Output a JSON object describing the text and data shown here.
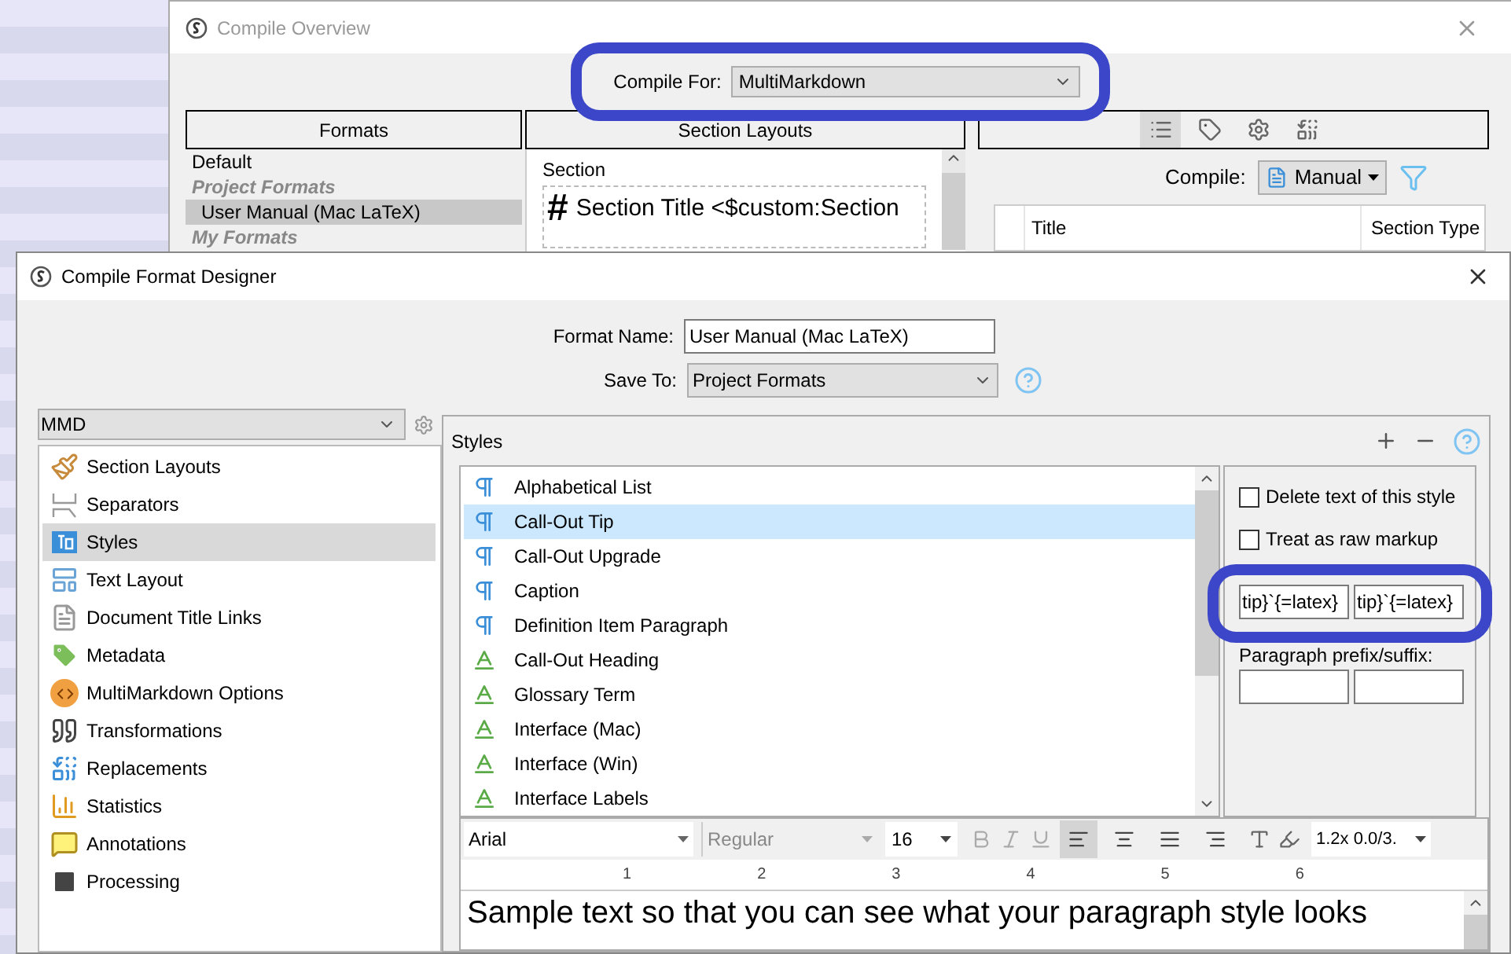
{
  "overview": {
    "title": "Compile Overview",
    "compile_for": {
      "label": "Compile For:",
      "value": "MultiMarkdown"
    },
    "headers": [
      "Formats",
      "Section Layouts"
    ],
    "view_tabs": [
      {
        "selected": true
      },
      {
        "selected": false
      },
      {
        "selected": false
      },
      {
        "selected": false
      }
    ],
    "formats": [
      {
        "kind": "item",
        "label": "Default",
        "selected": false
      },
      {
        "kind": "heading",
        "label": "Project Formats"
      },
      {
        "kind": "item",
        "label": "User Manual (Mac LaTeX)",
        "selected": true
      },
      {
        "kind": "heading",
        "label": "My Formats"
      }
    ],
    "section_layout": {
      "label": "Section",
      "marker": "#",
      "title": "Section Title <$custom:Section"
    },
    "compile": {
      "label": "Compile:",
      "value": "Manual"
    },
    "columns": [
      "Title",
      "Section Type"
    ]
  },
  "designer": {
    "title": "Compile Format Designer",
    "format_name": {
      "label": "Format Name:",
      "value": "User Manual (Mac LaTeX)"
    },
    "save_to": {
      "label": "Save To:",
      "value": "Project Formats"
    },
    "format_select": "MMD",
    "sidebar": [
      {
        "label": "Section Layouts",
        "selected": false
      },
      {
        "label": "Separators",
        "selected": false
      },
      {
        "label": "Styles",
        "selected": true
      },
      {
        "label": "Text Layout",
        "selected": false
      },
      {
        "label": "Document Title Links",
        "selected": false
      },
      {
        "label": "Metadata",
        "selected": false
      },
      {
        "label": "MultiMarkdown Options",
        "selected": false
      },
      {
        "label": "Transformations",
        "selected": false
      },
      {
        "label": "Replacements",
        "selected": false
      },
      {
        "label": "Statistics",
        "selected": false
      },
      {
        "label": "Annotations",
        "selected": false
      },
      {
        "label": "Processing",
        "selected": false
      }
    ],
    "styles_label": "Styles",
    "styles": [
      {
        "kind": "paragraph",
        "label": "Alphabetical List",
        "selected": false
      },
      {
        "kind": "paragraph",
        "label": "Call-Out Tip",
        "selected": true
      },
      {
        "kind": "paragraph",
        "label": "Call-Out Upgrade",
        "selected": false
      },
      {
        "kind": "paragraph",
        "label": "Caption",
        "selected": false
      },
      {
        "kind": "paragraph",
        "label": "Definition Item Paragraph",
        "selected": false
      },
      {
        "kind": "character",
        "label": "Call-Out Heading",
        "selected": false
      },
      {
        "kind": "character",
        "label": "Glossary Term",
        "selected": false
      },
      {
        "kind": "character",
        "label": "Interface (Mac)",
        "selected": false
      },
      {
        "kind": "character",
        "label": "Interface (Win)",
        "selected": false
      },
      {
        "kind": "character",
        "label": "Interface Labels",
        "selected": false
      }
    ],
    "options": [
      {
        "label": "Delete text of this style",
        "checked": false
      },
      {
        "label": "Treat as raw markup",
        "checked": false
      }
    ],
    "prefix_fields": [
      "tip}`{=latex}",
      "tip}`{=latex}"
    ],
    "paragraph_label": "Paragraph prefix/suffix:",
    "toolbar": {
      "font": "Arial",
      "style": "Regular",
      "size": "16",
      "bold": false,
      "italic": false,
      "underline": false,
      "align": [
        {
          "selected": true
        },
        {
          "selected": false
        },
        {
          "selected": false
        },
        {
          "selected": false
        }
      ],
      "spacing": "1.2x 0.0/3."
    },
    "ruler": [
      "1",
      "2",
      "3",
      "4",
      "5",
      "6"
    ],
    "sample_text": "Sample text so that you can see what your paragraph style looks"
  }
}
